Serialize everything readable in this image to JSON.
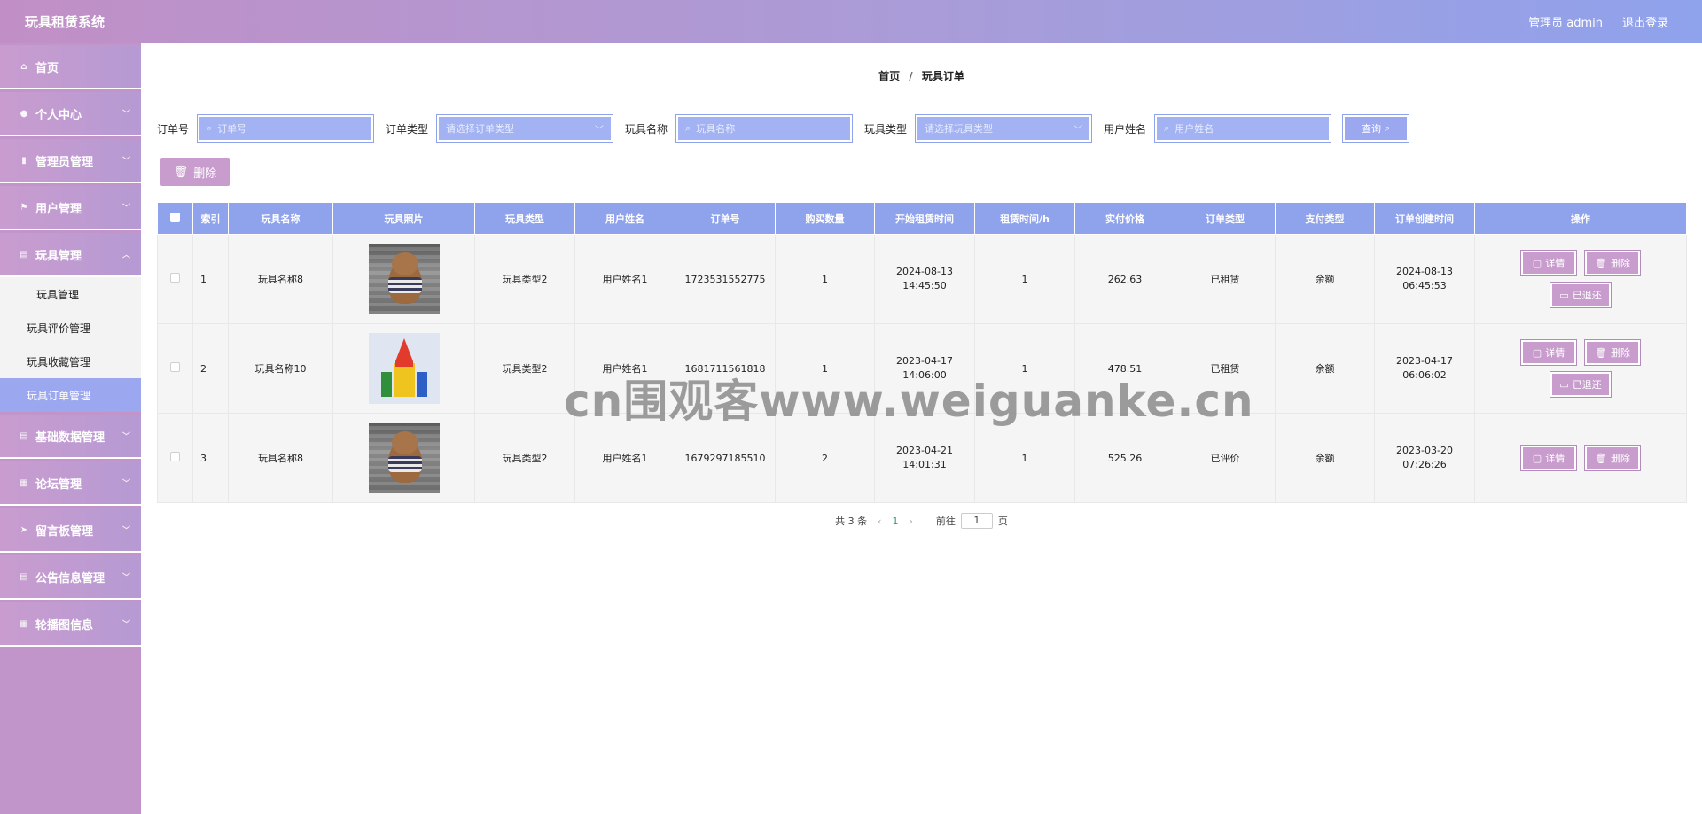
{
  "app": {
    "title": "玩具租赁系统"
  },
  "header": {
    "user_label": "管理员 admin",
    "logout_label": "退出登录"
  },
  "sidebar": {
    "items": [
      {
        "label": "首页",
        "icon": "home-icon"
      },
      {
        "label": "个人中心",
        "icon": "user-icon"
      },
      {
        "label": "管理员管理",
        "icon": "bar-chart-icon"
      },
      {
        "label": "用户管理",
        "icon": "flag-icon"
      },
      {
        "label": "玩具管理",
        "icon": "clipboard-icon"
      },
      {
        "label": "基础数据管理",
        "icon": "clipboard-icon"
      },
      {
        "label": "论坛管理",
        "icon": "grid-icon"
      },
      {
        "label": "留言板管理",
        "icon": "send-icon"
      },
      {
        "label": "公告信息管理",
        "icon": "clipboard-icon"
      },
      {
        "label": "轮播图信息",
        "icon": "grid-icon"
      }
    ],
    "submenu": [
      "玩具管理",
      "玩具评价管理",
      "玩具收藏管理",
      "玩具订单管理"
    ],
    "active_sub": "玩具订单管理"
  },
  "breadcrumb": {
    "home": "首页",
    "sep": "/",
    "current": "玩具订单"
  },
  "search": {
    "order_no_label": "订单号",
    "order_no_placeholder": "订单号",
    "order_type_label": "订单类型",
    "order_type_placeholder": "请选择订单类型",
    "toy_name_label": "玩具名称",
    "toy_name_placeholder": "玩具名称",
    "toy_type_label": "玩具类型",
    "toy_type_placeholder": "请选择玩具类型",
    "user_name_label": "用户姓名",
    "user_name_placeholder": "用户姓名",
    "search_btn": "查询"
  },
  "toolbar": {
    "delete_btn": "删除"
  },
  "table": {
    "headers": [
      "",
      "索引",
      "玩具名称",
      "玩具照片",
      "玩具类型",
      "用户姓名",
      "订单号",
      "购买数量",
      "开始租赁时间",
      "租赁时间/h",
      "实付价格",
      "订单类型",
      "支付类型",
      "订单创建时间",
      "操作"
    ],
    "rows": [
      {
        "index": "1",
        "name": "玩具名称8",
        "photo": "bear",
        "type": "玩具类型2",
        "user": "用户姓名1",
        "order_no": "1723531552775",
        "qty": "1",
        "start": "2024-08-13 14:45:50",
        "hours": "1",
        "price": "262.63",
        "order_type": "已租赁",
        "pay_type": "余额",
        "created": "2024-08-13 06:45:53",
        "ops": [
          "详情",
          "删除",
          "已退还"
        ]
      },
      {
        "index": "2",
        "name": "玩具名称10",
        "photo": "blocks",
        "type": "玩具类型2",
        "user": "用户姓名1",
        "order_no": "1681711561818",
        "qty": "1",
        "start": "2023-04-17 14:06:00",
        "hours": "1",
        "price": "478.51",
        "order_type": "已租赁",
        "pay_type": "余额",
        "created": "2023-04-17 06:06:02",
        "ops": [
          "详情",
          "删除",
          "已退还"
        ]
      },
      {
        "index": "3",
        "name": "玩具名称8",
        "photo": "bear",
        "type": "玩具类型2",
        "user": "用户姓名1",
        "order_no": "1679297185510",
        "qty": "2",
        "start": "2023-04-21 14:01:31",
        "hours": "1",
        "price": "525.26",
        "order_type": "已评价",
        "pay_type": "余额",
        "created": "2023-03-20 07:26:26",
        "ops": [
          "详情",
          "删除"
        ]
      }
    ]
  },
  "pagination": {
    "total": "共 3 条",
    "page": "1",
    "goto_label": "前往",
    "goto_value": "1",
    "page_unit": "页"
  },
  "watermark": "cn围观客www.weiguanke.cn"
}
